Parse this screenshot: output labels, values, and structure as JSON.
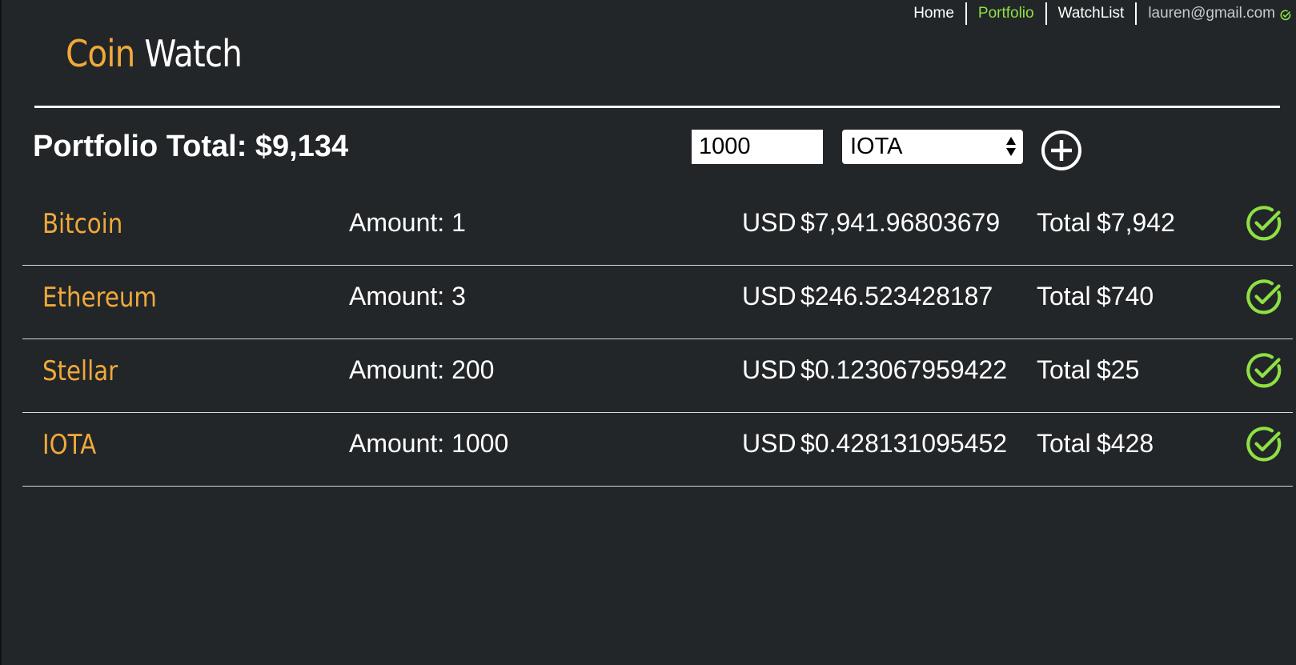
{
  "nav": {
    "links": [
      {
        "label": "Home",
        "active": false
      },
      {
        "label": "Portfolio",
        "active": true
      },
      {
        "label": "WatchList",
        "active": false
      }
    ],
    "user_email": "lauren@gmail.com",
    "user_status_icon": "check-circle-icon"
  },
  "logo": {
    "part1": "Coin",
    "part2": "Watch"
  },
  "toolbar": {
    "portfolio_total": "Portfolio Total: $9,134",
    "amount_value": "1000",
    "selected_coin": "IOTA",
    "add_icon": "plus-circle-icon"
  },
  "coins": [
    {
      "name": "Bitcoin",
      "amount": "Amount: 1",
      "usd_label": "USD",
      "price": "$7,941.96803679",
      "total_label": "Total",
      "total": "$7,942"
    },
    {
      "name": "Ethereum",
      "amount": "Amount: 3",
      "usd_label": "USD",
      "price": "$246.523428187",
      "total_label": "Total",
      "total": "$740"
    },
    {
      "name": "Stellar",
      "amount": "Amount: 200",
      "usd_label": "USD",
      "price": "$0.123067959422",
      "total_label": "Total",
      "total": "$25"
    },
    {
      "name": "IOTA",
      "amount": "Amount: 1000",
      "usd_label": "USD",
      "price": "$0.428131095452",
      "total_label": "Total",
      "total": "$428"
    }
  ],
  "colors": {
    "background": "#222629",
    "accent_orange": "#f0a93a",
    "accent_green": "#8ee044",
    "text": "#ffffff"
  }
}
